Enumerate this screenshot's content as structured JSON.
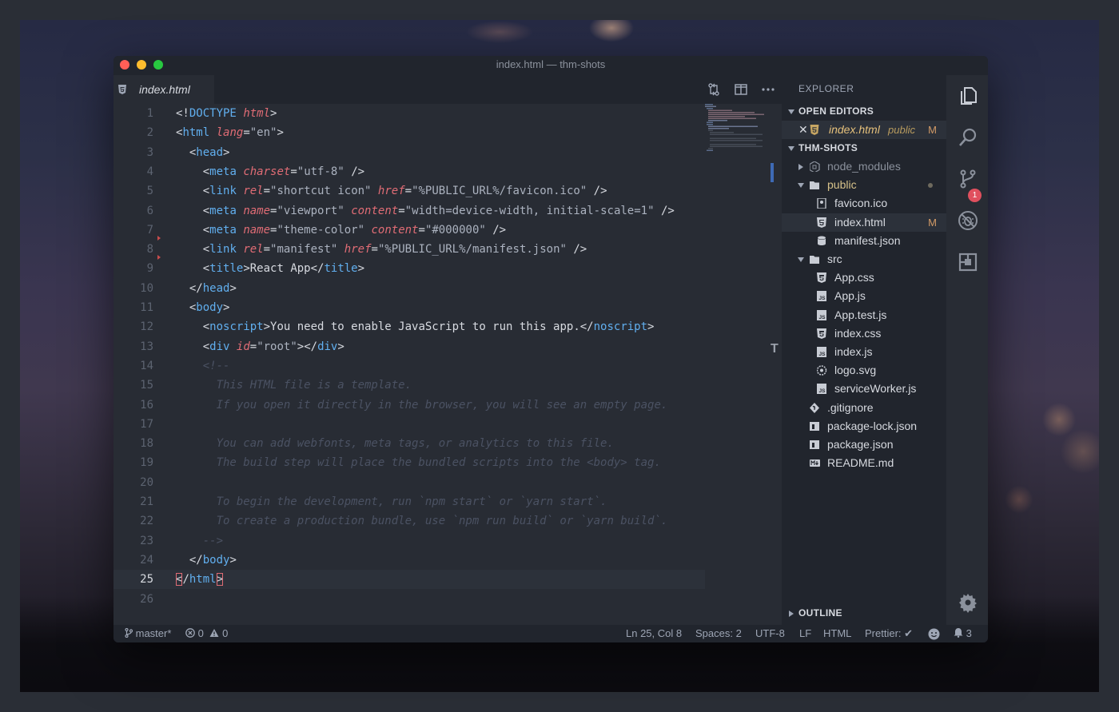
{
  "window": {
    "title": "index.html — thm-shots"
  },
  "tab": {
    "label": "index.html"
  },
  "editor": {
    "current_line": 25,
    "lines": [
      {
        "n": "1",
        "tokens": [
          [
            "pl",
            "<!"
          ],
          [
            "tg",
            "DOCTYPE"
          ],
          [
            "pl",
            " "
          ],
          [
            "at",
            "html"
          ],
          [
            "pl",
            ">"
          ]
        ]
      },
      {
        "n": "2",
        "tokens": [
          [
            "pl",
            "<"
          ],
          [
            "tg",
            "html"
          ],
          [
            "pl",
            " "
          ],
          [
            "at",
            "lang"
          ],
          [
            "pl",
            "="
          ],
          [
            "st",
            "\"en\""
          ],
          [
            "pl",
            ">"
          ]
        ]
      },
      {
        "n": "3",
        "tokens": [
          [
            "pl",
            "  <"
          ],
          [
            "tg",
            "head"
          ],
          [
            "pl",
            ">"
          ]
        ]
      },
      {
        "n": "4",
        "tokens": [
          [
            "pl",
            "    <"
          ],
          [
            "tg",
            "meta"
          ],
          [
            "pl",
            " "
          ],
          [
            "at",
            "charset"
          ],
          [
            "pl",
            "="
          ],
          [
            "st",
            "\"utf-8\""
          ],
          [
            "pl",
            " />"
          ]
        ]
      },
      {
        "n": "5",
        "tokens": [
          [
            "pl",
            "    <"
          ],
          [
            "tg",
            "link"
          ],
          [
            "pl",
            " "
          ],
          [
            "at",
            "rel"
          ],
          [
            "pl",
            "="
          ],
          [
            "st",
            "\"shortcut icon\""
          ],
          [
            "pl",
            " "
          ],
          [
            "at",
            "href"
          ],
          [
            "pl",
            "="
          ],
          [
            "st",
            "\"%PUBLIC_URL%/favicon.ico\""
          ],
          [
            "pl",
            " />"
          ]
        ]
      },
      {
        "n": "6",
        "tokens": [
          [
            "pl",
            "    <"
          ],
          [
            "tg",
            "meta"
          ],
          [
            "pl",
            " "
          ],
          [
            "at",
            "name"
          ],
          [
            "pl",
            "="
          ],
          [
            "st",
            "\"viewport\""
          ],
          [
            "pl",
            " "
          ],
          [
            "at",
            "content"
          ],
          [
            "pl",
            "="
          ],
          [
            "st",
            "\"width=device-width, initial-scale=1\""
          ],
          [
            "pl",
            " />"
          ]
        ]
      },
      {
        "n": "7",
        "tokens": [
          [
            "pl",
            "    <"
          ],
          [
            "tg",
            "meta"
          ],
          [
            "pl",
            " "
          ],
          [
            "at",
            "name"
          ],
          [
            "pl",
            "="
          ],
          [
            "st",
            "\"theme-color\""
          ],
          [
            "pl",
            " "
          ],
          [
            "at",
            "content"
          ],
          [
            "pl",
            "="
          ],
          [
            "st",
            "\"#000000\""
          ],
          [
            "pl",
            " />"
          ]
        ]
      },
      {
        "n": "8",
        "tokens": [
          [
            "pl",
            "    <"
          ],
          [
            "tg",
            "link"
          ],
          [
            "pl",
            " "
          ],
          [
            "at",
            "rel"
          ],
          [
            "pl",
            "="
          ],
          [
            "st",
            "\"manifest\""
          ],
          [
            "pl",
            " "
          ],
          [
            "at",
            "href"
          ],
          [
            "pl",
            "="
          ],
          [
            "st",
            "\"%PUBLIC_URL%/manifest.json\""
          ],
          [
            "pl",
            " />"
          ]
        ]
      },
      {
        "n": "9",
        "tokens": [
          [
            "pl",
            "    <"
          ],
          [
            "tg",
            "title"
          ],
          [
            "pl",
            ">React App</"
          ],
          [
            "tg",
            "title"
          ],
          [
            "pl",
            ">"
          ]
        ]
      },
      {
        "n": "10",
        "tokens": [
          [
            "pl",
            "  </"
          ],
          [
            "tg",
            "head"
          ],
          [
            "pl",
            ">"
          ]
        ]
      },
      {
        "n": "11",
        "tokens": [
          [
            "pl",
            "  <"
          ],
          [
            "tg",
            "body"
          ],
          [
            "pl",
            ">"
          ]
        ]
      },
      {
        "n": "12",
        "tokens": [
          [
            "pl",
            "    <"
          ],
          [
            "tg",
            "noscript"
          ],
          [
            "pl",
            ">You need to enable JavaScript to run this app.</"
          ],
          [
            "tg",
            "noscript"
          ],
          [
            "pl",
            ">"
          ]
        ]
      },
      {
        "n": "13",
        "tokens": [
          [
            "pl",
            "    <"
          ],
          [
            "tg",
            "div"
          ],
          [
            "pl",
            " "
          ],
          [
            "at",
            "id"
          ],
          [
            "pl",
            "="
          ],
          [
            "st",
            "\"root\""
          ],
          [
            "pl",
            "></"
          ],
          [
            "tg",
            "div"
          ],
          [
            "pl",
            ">"
          ]
        ]
      },
      {
        "n": "14",
        "tokens": [
          [
            "cm",
            "    <!--"
          ]
        ]
      },
      {
        "n": "15",
        "tokens": [
          [
            "cm",
            "      This HTML file is a template."
          ]
        ]
      },
      {
        "n": "16",
        "tokens": [
          [
            "cm",
            "      If you open it directly in the browser, you will see an empty page."
          ]
        ]
      },
      {
        "n": "17",
        "tokens": [
          [
            "cm",
            ""
          ]
        ]
      },
      {
        "n": "18",
        "tokens": [
          [
            "cm",
            "      You can add webfonts, meta tags, or analytics to this file."
          ]
        ]
      },
      {
        "n": "19",
        "tokens": [
          [
            "cm",
            "      The build step will place the bundled scripts into the <body> tag."
          ]
        ]
      },
      {
        "n": "20",
        "tokens": [
          [
            "cm",
            ""
          ]
        ]
      },
      {
        "n": "21",
        "tokens": [
          [
            "cm",
            "      To begin the development, run `npm start` or `yarn start`."
          ]
        ]
      },
      {
        "n": "22",
        "tokens": [
          [
            "cm",
            "      To create a production bundle, use `npm run build` or `yarn build`."
          ]
        ]
      },
      {
        "n": "23",
        "tokens": [
          [
            "cm",
            "    -->"
          ]
        ]
      },
      {
        "n": "24",
        "tokens": [
          [
            "pl",
            "  </"
          ],
          [
            "tg",
            "body"
          ],
          [
            "pl",
            ">"
          ]
        ]
      },
      {
        "n": "25",
        "tokens": [
          [
            "bx",
            "<"
          ],
          [
            "pl",
            "/"
          ],
          [
            "tg",
            "html"
          ],
          [
            "bx",
            ">"
          ]
        ]
      },
      {
        "n": "26",
        "tokens": []
      }
    ]
  },
  "explorer": {
    "header": "EXPLORER",
    "open_editors": {
      "label": "OPEN EDITORS",
      "file": "index.html",
      "folder": "public",
      "status": "M"
    },
    "project": {
      "label": "THM-SHOTS",
      "items": [
        {
          "label": "node_modules",
          "depth": 0,
          "kind": "folder",
          "state": "collapsed",
          "icon": "node-icon",
          "color": "#8b919c"
        },
        {
          "label": "public",
          "depth": 0,
          "kind": "folder",
          "state": "expanded",
          "icon": "folder-icon",
          "color": "#d7c28a",
          "dot": true
        },
        {
          "label": "favicon.ico",
          "depth": 1,
          "kind": "file",
          "icon": "image-file-icon",
          "color": "#d7dae0"
        },
        {
          "label": "index.html",
          "depth": 1,
          "kind": "file",
          "icon": "html-file-icon",
          "color": "#d7dae0",
          "status": "M",
          "active": true
        },
        {
          "label": "manifest.json",
          "depth": 1,
          "kind": "file",
          "icon": "database-icon",
          "color": "#d7dae0"
        },
        {
          "label": "src",
          "depth": 0,
          "kind": "folder",
          "state": "expanded",
          "icon": "folder-icon",
          "color": "#d7dae0"
        },
        {
          "label": "App.css",
          "depth": 1,
          "kind": "file",
          "icon": "css-file-icon",
          "color": "#d7dae0"
        },
        {
          "label": "App.js",
          "depth": 1,
          "kind": "file",
          "icon": "js-file-icon",
          "color": "#d7dae0"
        },
        {
          "label": "App.test.js",
          "depth": 1,
          "kind": "file",
          "icon": "js-file-icon",
          "color": "#d7dae0"
        },
        {
          "label": "index.css",
          "depth": 1,
          "kind": "file",
          "icon": "css-file-icon",
          "color": "#d7dae0"
        },
        {
          "label": "index.js",
          "depth": 1,
          "kind": "file",
          "icon": "js-file-icon",
          "color": "#d7dae0"
        },
        {
          "label": "logo.svg",
          "depth": 1,
          "kind": "file",
          "icon": "svg-file-icon",
          "color": "#d7dae0"
        },
        {
          "label": "serviceWorker.js",
          "depth": 1,
          "kind": "file",
          "icon": "js-file-icon",
          "color": "#d7dae0"
        },
        {
          "label": ".gitignore",
          "depth": 0,
          "kind": "file",
          "icon": "git-icon",
          "color": "#d7dae0"
        },
        {
          "label": "package-lock.json",
          "depth": 0,
          "kind": "file",
          "icon": "npm-icon",
          "color": "#d7dae0"
        },
        {
          "label": "package.json",
          "depth": 0,
          "kind": "file",
          "icon": "npm-icon",
          "color": "#d7dae0"
        },
        {
          "label": "README.md",
          "depth": 0,
          "kind": "file",
          "icon": "markdown-icon",
          "color": "#d7dae0"
        }
      ]
    },
    "outline": {
      "label": "OUTLINE"
    }
  },
  "activity_bar": {
    "items": [
      "files-icon",
      "search-icon",
      "source-control-icon",
      "debug-icon",
      "extensions-icon"
    ],
    "scm_badge": "1",
    "settings_icon": "gear-icon"
  },
  "statusbar": {
    "branch": "master*",
    "errors": "0",
    "warnings": "0",
    "position": "Ln 25, Col 8",
    "spaces": "Spaces: 2",
    "encoding": "UTF-8",
    "eol": "LF",
    "language": "HTML",
    "prettier": "Prettier: ✔",
    "notifications": "3"
  },
  "colors": {
    "tag": "#61afef",
    "attribute": "#e06c75",
    "string": "#abb2bf",
    "comment": "#4b5263",
    "modified": "#d19a66",
    "badge": "#e0505e"
  }
}
